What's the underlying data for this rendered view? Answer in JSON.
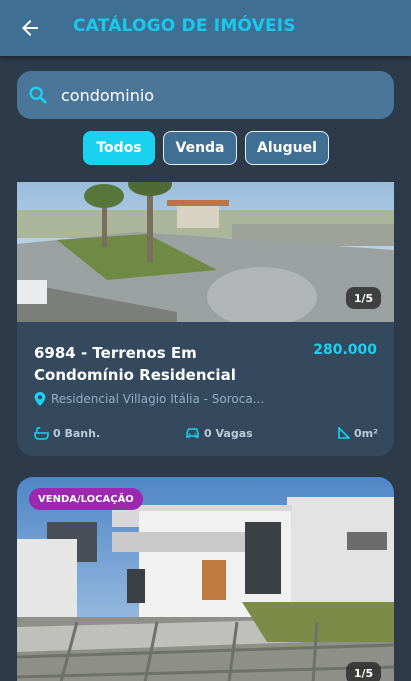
{
  "app": {
    "title": "CATÁLOGO DE IMÓVEIS",
    "icons": {
      "back": "arrow-left-icon",
      "search": "search-icon"
    }
  },
  "search": {
    "value": "condominio",
    "placeholder": ""
  },
  "filters": {
    "all": "Todos",
    "sale": "Venda",
    "rent": "Aluguel",
    "active": "Todos"
  },
  "colors": {
    "accent": "#1ad1f0",
    "appbar": "#3f6f93",
    "background": "#2c3a4a",
    "card": "#34495e",
    "badge": "#9c27b0"
  },
  "listings": [
    {
      "title": "6984 - Terrenos Em Condomínio Residencial",
      "price": "280.000",
      "address": "Residencial Villagio Itália - Soroca...",
      "bathrooms": "0 Banh.",
      "parking": "0 Vagas",
      "area": "0m²",
      "pager": "1/5"
    },
    {
      "badge": "VENDA/LOCAÇÃO",
      "pager": "1/5"
    }
  ]
}
